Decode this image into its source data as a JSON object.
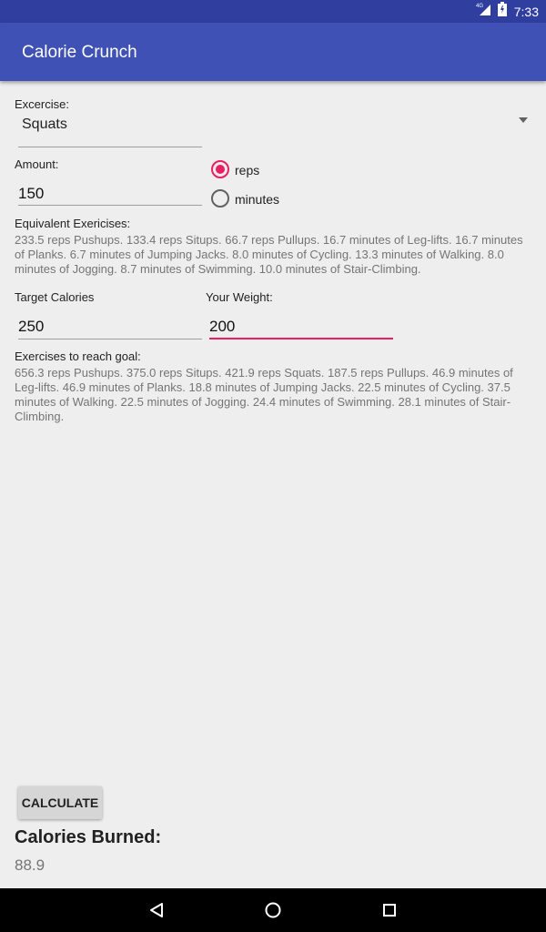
{
  "status_bar": {
    "network": "4G",
    "time": "7:33"
  },
  "app_bar": {
    "title": "Calorie Crunch"
  },
  "exercise": {
    "label": "Excercise:",
    "selected": "Squats"
  },
  "amount": {
    "label": "Amount:",
    "value": "150",
    "unit_options": [
      {
        "label": "reps",
        "checked": true
      },
      {
        "label": "minutes",
        "checked": false
      }
    ]
  },
  "equivalent": {
    "label": "Equivalent Exericises:",
    "text": "233.5 reps Pushups. 133.4 reps Situps. 66.7 reps Pullups. 16.7 minutes of Leg-lifts. 16.7 minutes of Planks. 6.7 minutes of Jumping Jacks. 8.0 minutes of Cycling. 13.3 minutes of Walking. 8.0 minutes of Jogging. 8.7 minutes of Swimming. 10.0 minutes of Stair-Climbing."
  },
  "target": {
    "label": "Target Calories",
    "value": "250"
  },
  "weight": {
    "label": "Your Weight:",
    "value": "200"
  },
  "goal": {
    "label": "Exercises to reach goal:",
    "text": "656.3 reps Pushups. 375.0 reps Situps. 421.9 reps Squats. 187.5 reps Pullups. 46.9 minutes of Leg-lifts. 46.9 minutes of Planks. 18.8 minutes of Jumping Jacks. 22.5 minutes of Cycling. 37.5 minutes of Walking. 22.5 minutes of Jogging. 24.4 minutes of Swimming. 28.1 minutes of Stair-Climbing."
  },
  "calculate_label": "CALCULATE",
  "result": {
    "title": "Calories Burned:",
    "value": "88.9"
  },
  "colors": {
    "primary": "#3f51b5",
    "primary_dark": "#303f9f",
    "accent": "#e91e63"
  },
  "icons": [
    "signal-icon",
    "battery-icon",
    "back-icon",
    "home-icon",
    "recents-icon",
    "dropdown-arrow-icon"
  ]
}
